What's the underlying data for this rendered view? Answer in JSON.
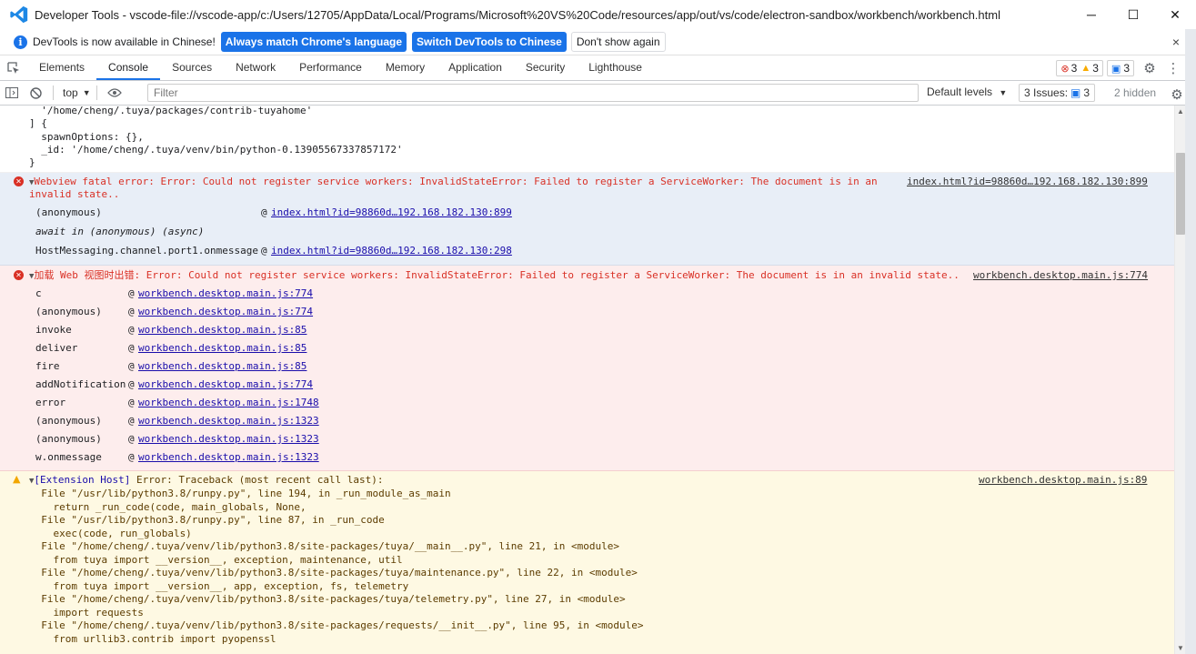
{
  "window": {
    "title": "Developer Tools - vscode-file://vscode-app/c:/Users/12705/AppData/Local/Programs/Microsoft%20VS%20Code/resources/app/out/vs/code/electron-sandbox/workbench/workbench.html",
    "minimize": "─",
    "maximize": "☐",
    "close": "✕"
  },
  "infobar": {
    "message": "DevTools is now available in Chinese!",
    "match_button": "Always match Chrome's language",
    "switch_button": "Switch DevTools to Chinese",
    "dismiss_button": "Don't show again",
    "close": "×"
  },
  "tabs": [
    "Elements",
    "Console",
    "Sources",
    "Network",
    "Performance",
    "Memory",
    "Application",
    "Security",
    "Lighthouse"
  ],
  "active_tab": "Console",
  "counts": {
    "errors": "3",
    "warnings": "3",
    "messages": "3"
  },
  "toolbar": {
    "context": "top",
    "filter_placeholder": "Filter",
    "levels": "Default levels",
    "issues_label": "3 Issues:",
    "issues_count": "3",
    "hidden": "2 hidden"
  },
  "console": {
    "top_lines": [
      "  '/home/cheng/.tuya/packages/contrib-tuyahome'",
      "] {",
      "  spawnOptions: {},",
      "  _id: '/home/cheng/.tuya/venv/bin/python-0.13905567337857172'",
      "}"
    ],
    "msg1": {
      "line1": "Webview fatal error: Error: Could not register service workers: InvalidStateError: Failed to register a ServiceWorker: The document is in an",
      "line2": "invalid state..",
      "source": "index.html?id=98860d…192.168.182.130:899",
      "stack": [
        {
          "fn": "(anonymous)",
          "at": "@",
          "link": "index.html?id=98860d…192.168.182.130:899"
        },
        {
          "fn": "await in (anonymous) (async)",
          "at": "",
          "link": ""
        },
        {
          "fn": "HostMessaging.channel.port1.onmessage",
          "at": "@",
          "link": "index.html?id=98860d…192.168.182.130:298"
        }
      ]
    },
    "msg2": {
      "line1": "加载 Web 视图时出错: Error: Could not register service workers: InvalidStateError: Failed to register a ServiceWorker: The document is in an invalid state..",
      "source": "workbench.desktop.main.js:774",
      "stack": [
        {
          "fn": "c",
          "link": "workbench.desktop.main.js:774"
        },
        {
          "fn": "(anonymous)",
          "link": "workbench.desktop.main.js:774"
        },
        {
          "fn": "invoke",
          "link": "workbench.desktop.main.js:85"
        },
        {
          "fn": "deliver",
          "link": "workbench.desktop.main.js:85"
        },
        {
          "fn": "fire",
          "link": "workbench.desktop.main.js:85"
        },
        {
          "fn": "addNotification",
          "link": "workbench.desktop.main.js:774"
        },
        {
          "fn": "error",
          "link": "workbench.desktop.main.js:1748"
        },
        {
          "fn": "(anonymous)",
          "link": "workbench.desktop.main.js:1323"
        },
        {
          "fn": "(anonymous)",
          "link": "workbench.desktop.main.js:1323"
        },
        {
          "fn": "w.onmessage",
          "link": "workbench.desktop.main.js:1323"
        }
      ]
    },
    "msg3": {
      "prefix": "[Extension Host]",
      "line1": " Error: Traceback (most recent call last):",
      "source": "workbench.desktop.main.js:89",
      "lines": [
        "  File \"/usr/lib/python3.8/runpy.py\", line 194, in _run_module_as_main",
        "    return _run_code(code, main_globals, None,",
        "  File \"/usr/lib/python3.8/runpy.py\", line 87, in _run_code",
        "    exec(code, run_globals)",
        "  File \"/home/cheng/.tuya/venv/lib/python3.8/site-packages/tuya/__main__.py\", line 21, in <module>",
        "    from tuya import __version__, exception, maintenance, util",
        "  File \"/home/cheng/.tuya/venv/lib/python3.8/site-packages/tuya/maintenance.py\", line 22, in <module>",
        "    from tuya import __version__, app, exception, fs, telemetry",
        "  File \"/home/cheng/.tuya/venv/lib/python3.8/site-packages/tuya/telemetry.py\", line 27, in <module>",
        "    import requests",
        "  File \"/home/cheng/.tuya/venv/lib/python3.8/site-packages/requests/__init__.py\", line 95, in <module>",
        "    from urllib3.contrib import pyopenssl"
      ]
    }
  },
  "colors": {
    "accent": "#1a73e8",
    "error": "#d93025",
    "warning": "#f2a600"
  }
}
